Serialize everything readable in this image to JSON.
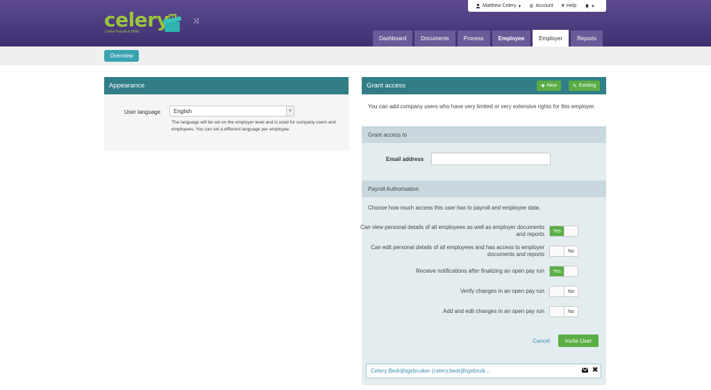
{
  "logo": {
    "name": "celery",
    "tagline": "Online Payroll & HRM"
  },
  "user_bar": {
    "user_name": "Matthew Celery",
    "account_label": "Account",
    "help_label": "Help"
  },
  "nav": {
    "tabs": [
      {
        "label": "Dashboard"
      },
      {
        "label": "Documents"
      },
      {
        "label": "Process"
      },
      {
        "label": "Employee"
      },
      {
        "label": "Employer"
      },
      {
        "label": "Reports"
      }
    ]
  },
  "subbar": {
    "overview_label": "Overview"
  },
  "appearance": {
    "title": "Appearance",
    "language_label": "User language",
    "language_value": "English",
    "help_text": "The language will be set on the employer level and is used for company users and employees. You can set a different language per employee."
  },
  "grant": {
    "title": "Grant access",
    "new_label": "New",
    "existing_label": "Existing",
    "intro": "You can add company users who have very limited or very extensive rights for this employer.",
    "grant_to_title": "Grant access to",
    "email_label": "Email address",
    "email_value": "",
    "payroll_title": "Payroll Authorisation",
    "payroll_desc": "Choose how much access this user has to payroll and employee data.",
    "permissions": [
      {
        "text": "Can view personal details of all employees as well as employer documents and reports",
        "value": "Yes"
      },
      {
        "text": "Can edit personal details of all employees and has access to employer documents and reports",
        "value": "No"
      },
      {
        "text": "Receive notifications after finalizing an open pay run",
        "value": "Yes"
      },
      {
        "text": "Verify changes in an open pay run",
        "value": "No"
      },
      {
        "text": "Add and edit changes in an open pay run",
        "value": "No"
      }
    ],
    "cancel_label": "Cancel",
    "invite_label": "Invite User",
    "existing_user": "Celery Bedrijfsgebruiker (celery.bedrijfsgebruik..."
  },
  "colors": {
    "header": "#4e3d80",
    "teal": "#317e87",
    "green": "#5aae45",
    "logo_green": "#9bc53d"
  }
}
